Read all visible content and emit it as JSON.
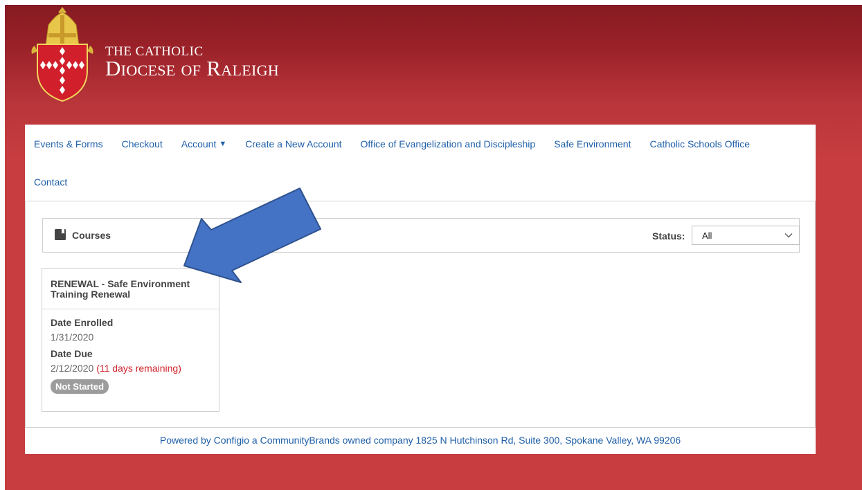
{
  "brand": {
    "line1": "THE CATHOLIC",
    "line2": "Diocese of Raleigh"
  },
  "nav": {
    "items": [
      {
        "label": "Events & Forms"
      },
      {
        "label": "Checkout"
      },
      {
        "label": "Account",
        "icon": "caret-down-icon"
      },
      {
        "label": "Create a New Account"
      },
      {
        "label": "Office of Evangelization and Discipleship"
      },
      {
        "label": "Safe Environment"
      },
      {
        "label": "Catholic Schools Office"
      },
      {
        "label": "Contact"
      }
    ]
  },
  "courses": {
    "title": "Courses",
    "icon": "book-icon",
    "status_label": "Status:",
    "status_value": "All"
  },
  "card": {
    "title": "RENEWAL - Safe Environment Training Renewal",
    "date_enrolled_label": "Date Enrolled",
    "date_enrolled": "1/31/2020",
    "date_due_label": "Date Due",
    "date_due": "2/12/2020",
    "remaining": "(11 days remaining)",
    "status": "Not Started"
  },
  "footer": {
    "text": "Powered by Configio a CommunityBrands owned company 1825 N Hutchinson Rd, Suite 300, Spokane Valley, WA 99206"
  },
  "colors": {
    "brand_red": "#c73d40",
    "header_dark_red": "#861a22",
    "link_blue": "#1f5fa8",
    "arrow_blue": "#4472c4",
    "remaining_red": "#d1222a",
    "badge_gray": "#9c9c9c"
  }
}
